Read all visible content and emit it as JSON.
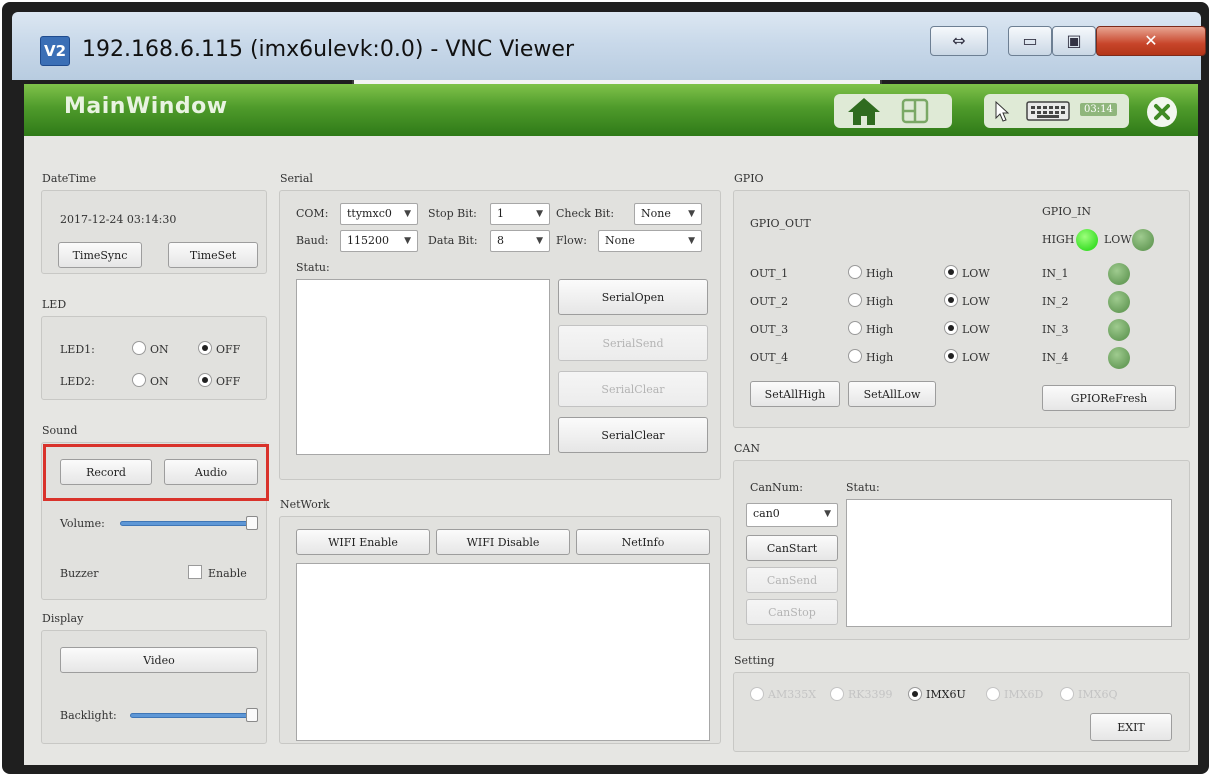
{
  "vnc": {
    "logo": "V2",
    "title": "192.168.6.115 (imx6ulevk:0.0) - VNC Viewer",
    "controls": {
      "fit": "⇔",
      "minimize": "▭",
      "maximize": "▣",
      "close": "✕"
    }
  },
  "header": {
    "title": "MainWindow",
    "clock": "03:14"
  },
  "datetime": {
    "title": "DateTime",
    "value": "2017-12-24 03:14:30",
    "sync_label": "TimeSync",
    "set_label": "TimeSet"
  },
  "led": {
    "title": "LED",
    "rows": [
      {
        "label": "LED1:",
        "on": "ON",
        "off": "OFF",
        "state": "OFF"
      },
      {
        "label": "LED2:",
        "on": "ON",
        "off": "OFF",
        "state": "OFF"
      }
    ]
  },
  "sound": {
    "title": "Sound",
    "record_label": "Record",
    "audio_label": "Audio",
    "volume_label": "Volume:",
    "volume_level": 0.95,
    "buzzer_label": "Buzzer",
    "buzzer_enable_label": "Enable",
    "buzzer_enabled": false
  },
  "display": {
    "title": "Display",
    "video_label": "Video",
    "backlight_label": "Backlight:",
    "backlight_level": 0.95
  },
  "serial": {
    "title": "Serial",
    "com_label": "COM:",
    "com_value": "ttymxc0",
    "stopbit_label": "Stop Bit:",
    "stopbit_value": "1",
    "checkbit_label": "Check Bit:",
    "checkbit_value": "None",
    "baud_label": "Baud:",
    "baud_value": "115200",
    "databit_label": "Data Bit:",
    "databit_value": "8",
    "flow_label": "Flow:",
    "flow_value": "None",
    "status_label": "Statu:",
    "open_label": "SerialOpen",
    "send_label": "SerialSend",
    "clear_disabled_label": "SerialClear",
    "clear_label": "SerialClear"
  },
  "network": {
    "title": "NetWork",
    "wifi_enable_label": "WIFI Enable",
    "wifi_disable_label": "WIFI Disable",
    "netinfo_label": "NetInfo"
  },
  "gpio": {
    "title": "GPIO",
    "out_title": "GPIO_OUT",
    "in_title": "GPIO_IN",
    "legend_high": "HIGH",
    "legend_low": "LOW",
    "high_label": "High",
    "low_label": "LOW",
    "outputs": [
      {
        "label": "OUT_1",
        "state": "LOW"
      },
      {
        "label": "OUT_2",
        "state": "LOW"
      },
      {
        "label": "OUT_3",
        "state": "LOW"
      },
      {
        "label": "OUT_4",
        "state": "LOW"
      }
    ],
    "inputs": [
      {
        "label": "IN_1",
        "state": "LOW"
      },
      {
        "label": "IN_2",
        "state": "LOW"
      },
      {
        "label": "IN_3",
        "state": "LOW"
      },
      {
        "label": "IN_4",
        "state": "LOW"
      }
    ],
    "set_all_high_label": "SetAllHigh",
    "set_all_low_label": "SetAllLow",
    "refresh_label": "GPIOReFresh"
  },
  "can": {
    "title": "CAN",
    "num_label": "CanNum:",
    "status_label": "Statu:",
    "num_value": "can0",
    "start_label": "CanStart",
    "send_label": "CanSend",
    "stop_label": "CanStop"
  },
  "setting": {
    "title": "Setting",
    "options": [
      "AM335X",
      "RK3399",
      "IMX6U",
      "IMX6D",
      "IMX6Q"
    ],
    "selected": "IMX6U",
    "exit_label": "EXIT"
  },
  "colors": {
    "header_green": "#4f9b2b",
    "highlight_red": "#d9322b",
    "led_on": "#3ee02a",
    "led_off": "#6a9f5c"
  }
}
